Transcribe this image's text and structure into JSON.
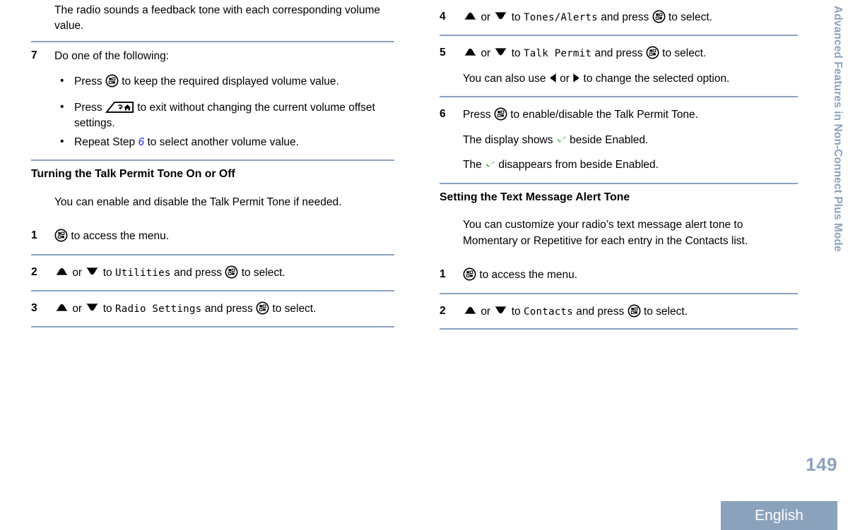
{
  "document": {
    "running_head": "Advanced Features in Non-Connect Plus Mode",
    "page_number": "149",
    "language_band": "English",
    "accent_color": "#8ba2bd",
    "link_color": "#1c27ee",
    "check_color": "#4aa845"
  },
  "left_column": {
    "intro_note": "The radio sounds a feedback tone with each corresponding volume value.",
    "step7": {
      "number": "7",
      "text": "Do one of the following:",
      "bullets": [
        {
          "dot": "•",
          "pre": "Press",
          "icon": "menu-button-icon",
          "post": "to keep the required displayed volume value."
        },
        {
          "dot": "•",
          "pre": "Press",
          "icon": "back-home-button-icon",
          "post": "to exit without changing the current volume offset settings."
        },
        {
          "dot": "•",
          "pre": "Repeat Step",
          "link": "6",
          "post": "to select another volume value."
        }
      ]
    },
    "heading": "Turning the Talk Permit Tone On or Off",
    "lede": "You can enable and disable the Talk Permit Tone if needed.",
    "steps": [
      {
        "number": "1",
        "icon": "menu-button-icon",
        "after_icon": "to access the menu."
      },
      {
        "number": "2",
        "up_icon": "up-triangle-icon",
        "or": "or",
        "down_icon": "down-triangle-icon",
        "to": "to",
        "menu_item": "Utilities",
        "and_press": "and press",
        "press_icon": "menu-button-icon",
        "tail": "to select."
      },
      {
        "number": "3",
        "up_icon": "up-triangle-icon",
        "or": "or",
        "down_icon": "down-triangle-icon",
        "to": "to",
        "menu_item": "Radio Settings",
        "and_press": "and press",
        "press_icon": "menu-button-icon",
        "tail": "to select."
      }
    ]
  },
  "right_column": {
    "steps": [
      {
        "number": "4",
        "up_icon": "up-triangle-icon",
        "or": "or",
        "down_icon": "down-triangle-icon",
        "to": "to",
        "menu_item": "Tones/Alerts",
        "and_press": "and press",
        "press_icon": "menu-button-icon",
        "tail": "to select."
      },
      {
        "number": "5",
        "up_icon": "up-triangle-icon",
        "or": "or",
        "down_icon": "down-triangle-icon",
        "to": "to",
        "menu_item": "Talk Permit",
        "and_press": "and press",
        "press_icon": "menu-button-icon",
        "tail": "to select.",
        "note_pre": "You can also use",
        "note_left_icon": "left-triangle-icon",
        "note_or": "or",
        "note_right_icon": "right-triangle-icon",
        "note_post": "to change the selected option."
      },
      {
        "number": "6",
        "press_label": "Press",
        "press_icon": "menu-button-icon",
        "press_tail": "to enable/disable the Talk Permit Tone.",
        "result_1_pre": "The display shows",
        "result_1_icon": "check-icon",
        "result_1_post": "beside Enabled.",
        "result_2_pre": "The",
        "result_2_icon": "check-icon",
        "result_2_post": "disappears from beside Enabled."
      }
    ],
    "heading": "Setting the Text Message Alert Tone",
    "lede": "You can customize your radio’s text message alert tone to Momentary or Repetitive for each entry in the Contacts list.",
    "steps2": [
      {
        "number": "1",
        "icon": "menu-button-icon",
        "after_icon": "to access the menu."
      },
      {
        "number": "2",
        "up_icon": "up-triangle-icon",
        "or": "or",
        "down_icon": "down-triangle-icon",
        "to": "to",
        "menu_item": "Contacts",
        "and_press": "and press",
        "press_icon": "menu-button-icon",
        "tail": "to select."
      }
    ]
  }
}
